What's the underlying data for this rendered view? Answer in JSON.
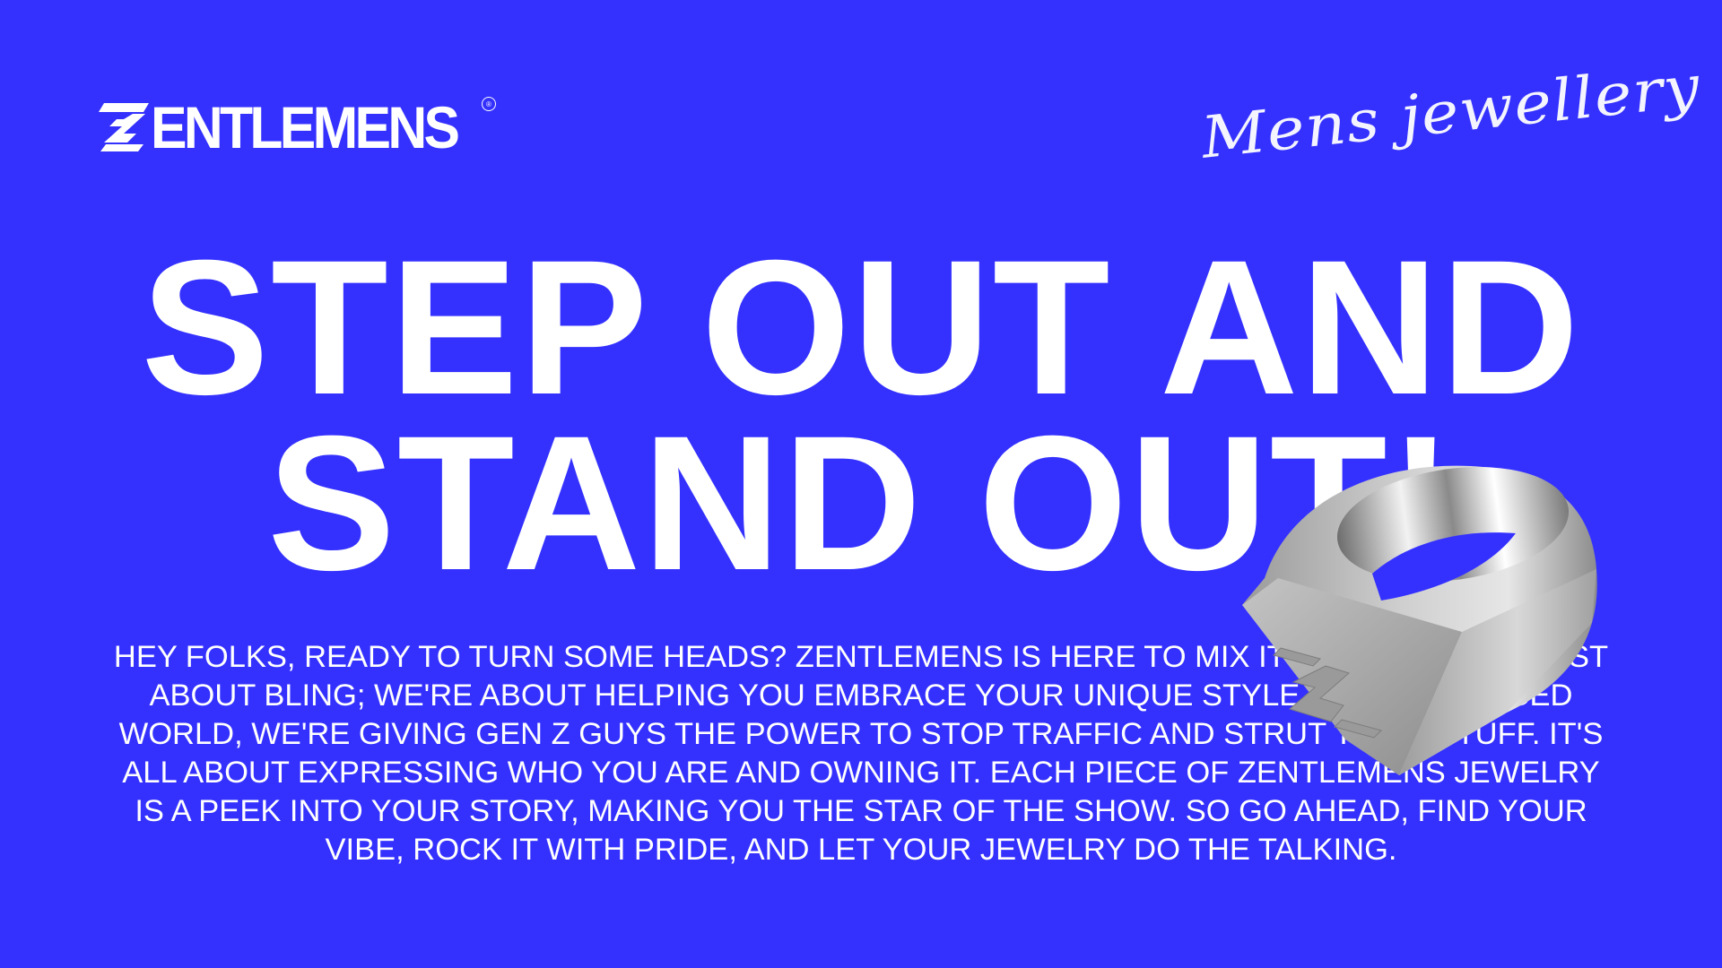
{
  "brand": {
    "logo_text": "ENTLEMENS",
    "logo_mark": "Z-bolt",
    "registered": "®"
  },
  "tagline": "Mens jewellery",
  "headline": [
    "STEP OUT AND",
    "STAND OUT!"
  ],
  "paragraph": [
    "HEY FOLKS, READY TO TURN SOME HEADS? ZENTLEMENS IS HERE TO MIX IT UP. WE'RE NOT JUST",
    "ABOUT BLING; WE'RE ABOUT HELPING YOU EMBRACE YOUR UNIQUE STYLE. IN A FAST-PACED",
    "WORLD, WE'RE GIVING GEN Z GUYS THE POWER TO STOP TRAFFIC AND STRUT THEIR STUFF. IT'S",
    "ALL ABOUT EXPRESSING WHO YOU ARE AND OWNING IT. EACH PIECE OF ZENTLEMENS JEWELRY",
    "IS A PEEK INTO YOUR STORY, MAKING YOU THE STAR OF THE SHOW. SO GO AHEAD, FIND YOUR",
    "VIBE, ROCK IT WITH PRIDE, AND LET YOUR JEWELRY DO THE TALKING."
  ],
  "colors": {
    "background": "#3431ff",
    "text": "#ffffff",
    "ring": "#b8b8b8"
  }
}
